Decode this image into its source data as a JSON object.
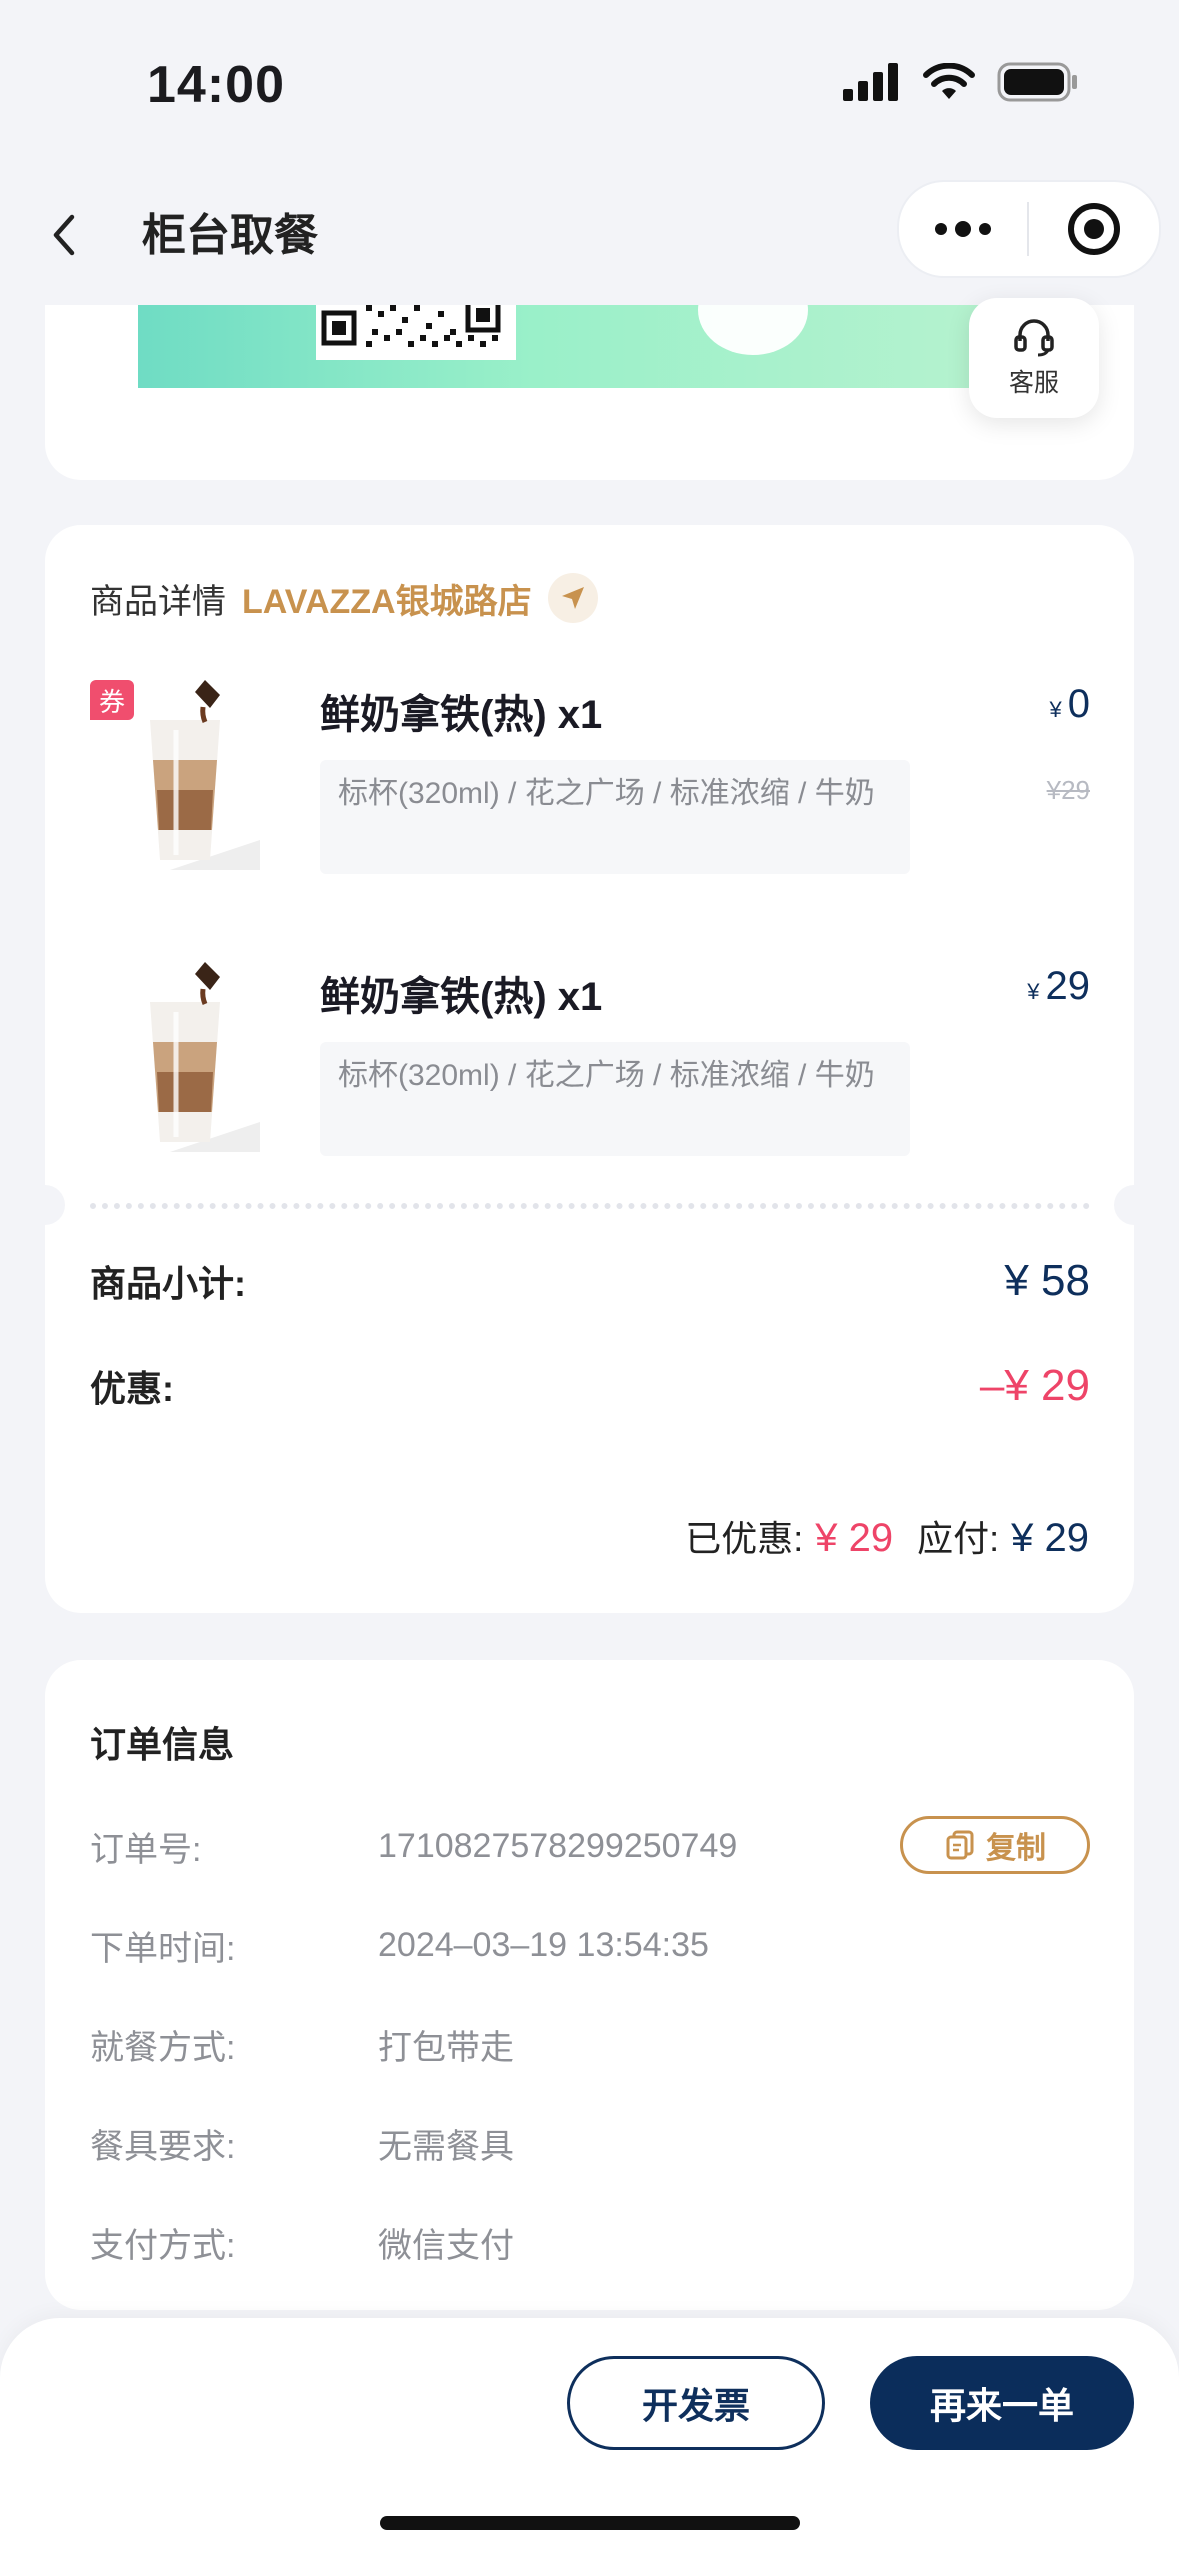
{
  "status_bar": {
    "time": "14:00"
  },
  "nav": {
    "title": "柜台取餐"
  },
  "service": {
    "label": "客服"
  },
  "goods": {
    "section_label": "商品详情",
    "store_name": "LAVAZZA银城路店",
    "coupon_tag": "券",
    "items": [
      {
        "name": "鲜奶拿铁(热) x1",
        "spec": "标杯(320ml) / 花之广场 / 标准浓缩 / 牛奶",
        "price": "0",
        "original_price": "¥29",
        "currency": "¥"
      },
      {
        "name": "鲜奶拿铁(热) x1",
        "spec": "标杯(320ml) / 花之广场 / 标准浓缩 / 牛奶",
        "price": "29",
        "currency": "¥"
      }
    ],
    "subtotal_label": "商品小计:",
    "subtotal_value": "¥ 58",
    "discount_label": "优惠:",
    "discount_value": "–¥ 29",
    "saved_label": "已优惠:",
    "saved_value": "¥ 29",
    "payable_label": "应付:",
    "payable_value": "¥ 29"
  },
  "order_info": {
    "title": "订单信息",
    "order_no_label": "订单号:",
    "order_no": "1710827578299250749",
    "copy_label": "复制",
    "time_label": "下单时间:",
    "time_value": "2024–03–19 13:54:35",
    "dining_label": "就餐方式:",
    "dining_value": "打包带走",
    "utensil_label": "餐具要求:",
    "utensil_value": "无需餐具",
    "payment_label": "支付方式:",
    "payment_value": "微信支付"
  },
  "actions": {
    "invoice": "开发票",
    "reorder": "再来一单"
  },
  "colors": {
    "navy": "#0e2f5c",
    "gold": "#c8924e",
    "red": "#ee4468"
  }
}
